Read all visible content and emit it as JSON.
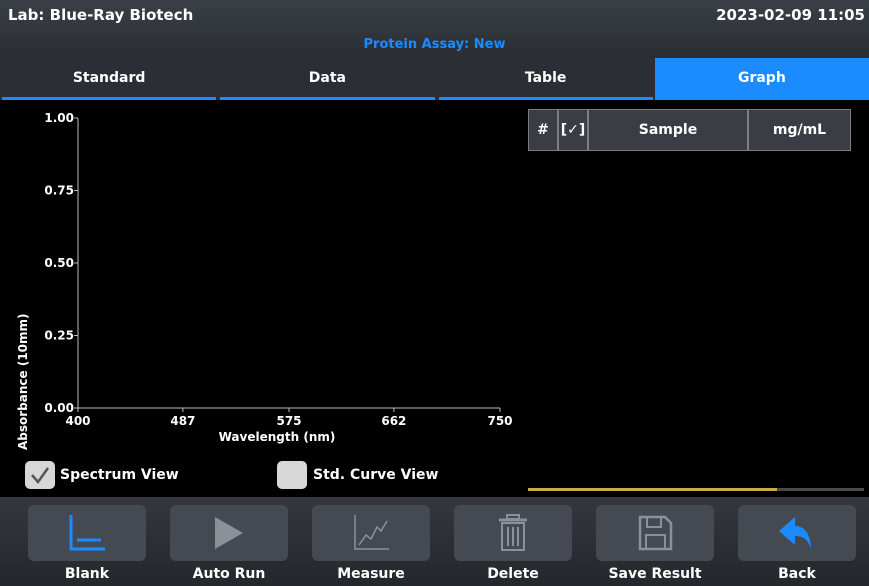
{
  "header": {
    "lab": "Lab: Blue-Ray Biotech",
    "datetime": "2023-02-09 11:05",
    "subtitle": "Protein Assay: New"
  },
  "tabs": [
    {
      "label": "Standard",
      "active": false
    },
    {
      "label": "Data",
      "active": false
    },
    {
      "label": "Table",
      "active": false
    },
    {
      "label": "Graph",
      "active": true
    }
  ],
  "chart_data": {
    "type": "line",
    "xlabel": "Wavelength (nm)",
    "ylabel": "Absorbance (10mm)",
    "xlim": [
      400,
      750
    ],
    "ylim": [
      0,
      1.0
    ],
    "x_ticks": [
      "400",
      "487",
      "575",
      "662",
      "750"
    ],
    "y_ticks": [
      "0.00",
      "0.25",
      "0.50",
      "0.75",
      "1.00"
    ],
    "series": []
  },
  "results_table": {
    "columns": [
      "#",
      "[✓]",
      "Sample",
      "mg/mL"
    ],
    "rows": []
  },
  "progress": 0.74,
  "view_options": {
    "spectrum_view": {
      "label": "Spectrum View",
      "checked": true
    },
    "std_curve_view": {
      "label": "Std. Curve View",
      "checked": false
    }
  },
  "toolbar": {
    "blank": {
      "label": "Blank",
      "icon": "axes-icon",
      "enabled": true
    },
    "auto_run": {
      "label": "Auto Run",
      "icon": "play-icon",
      "enabled": false
    },
    "measure": {
      "label": "Measure",
      "icon": "chart-line-icon",
      "enabled": false
    },
    "delete": {
      "label": "Delete",
      "icon": "trash-icon",
      "enabled": false
    },
    "save_result": {
      "label": "Save Result",
      "icon": "save-icon",
      "enabled": false
    },
    "back": {
      "label": "Back",
      "icon": "back-arrow-icon",
      "enabled": true
    }
  },
  "colors": {
    "accent": "#1a8cff",
    "progress": "#c9a94a"
  }
}
